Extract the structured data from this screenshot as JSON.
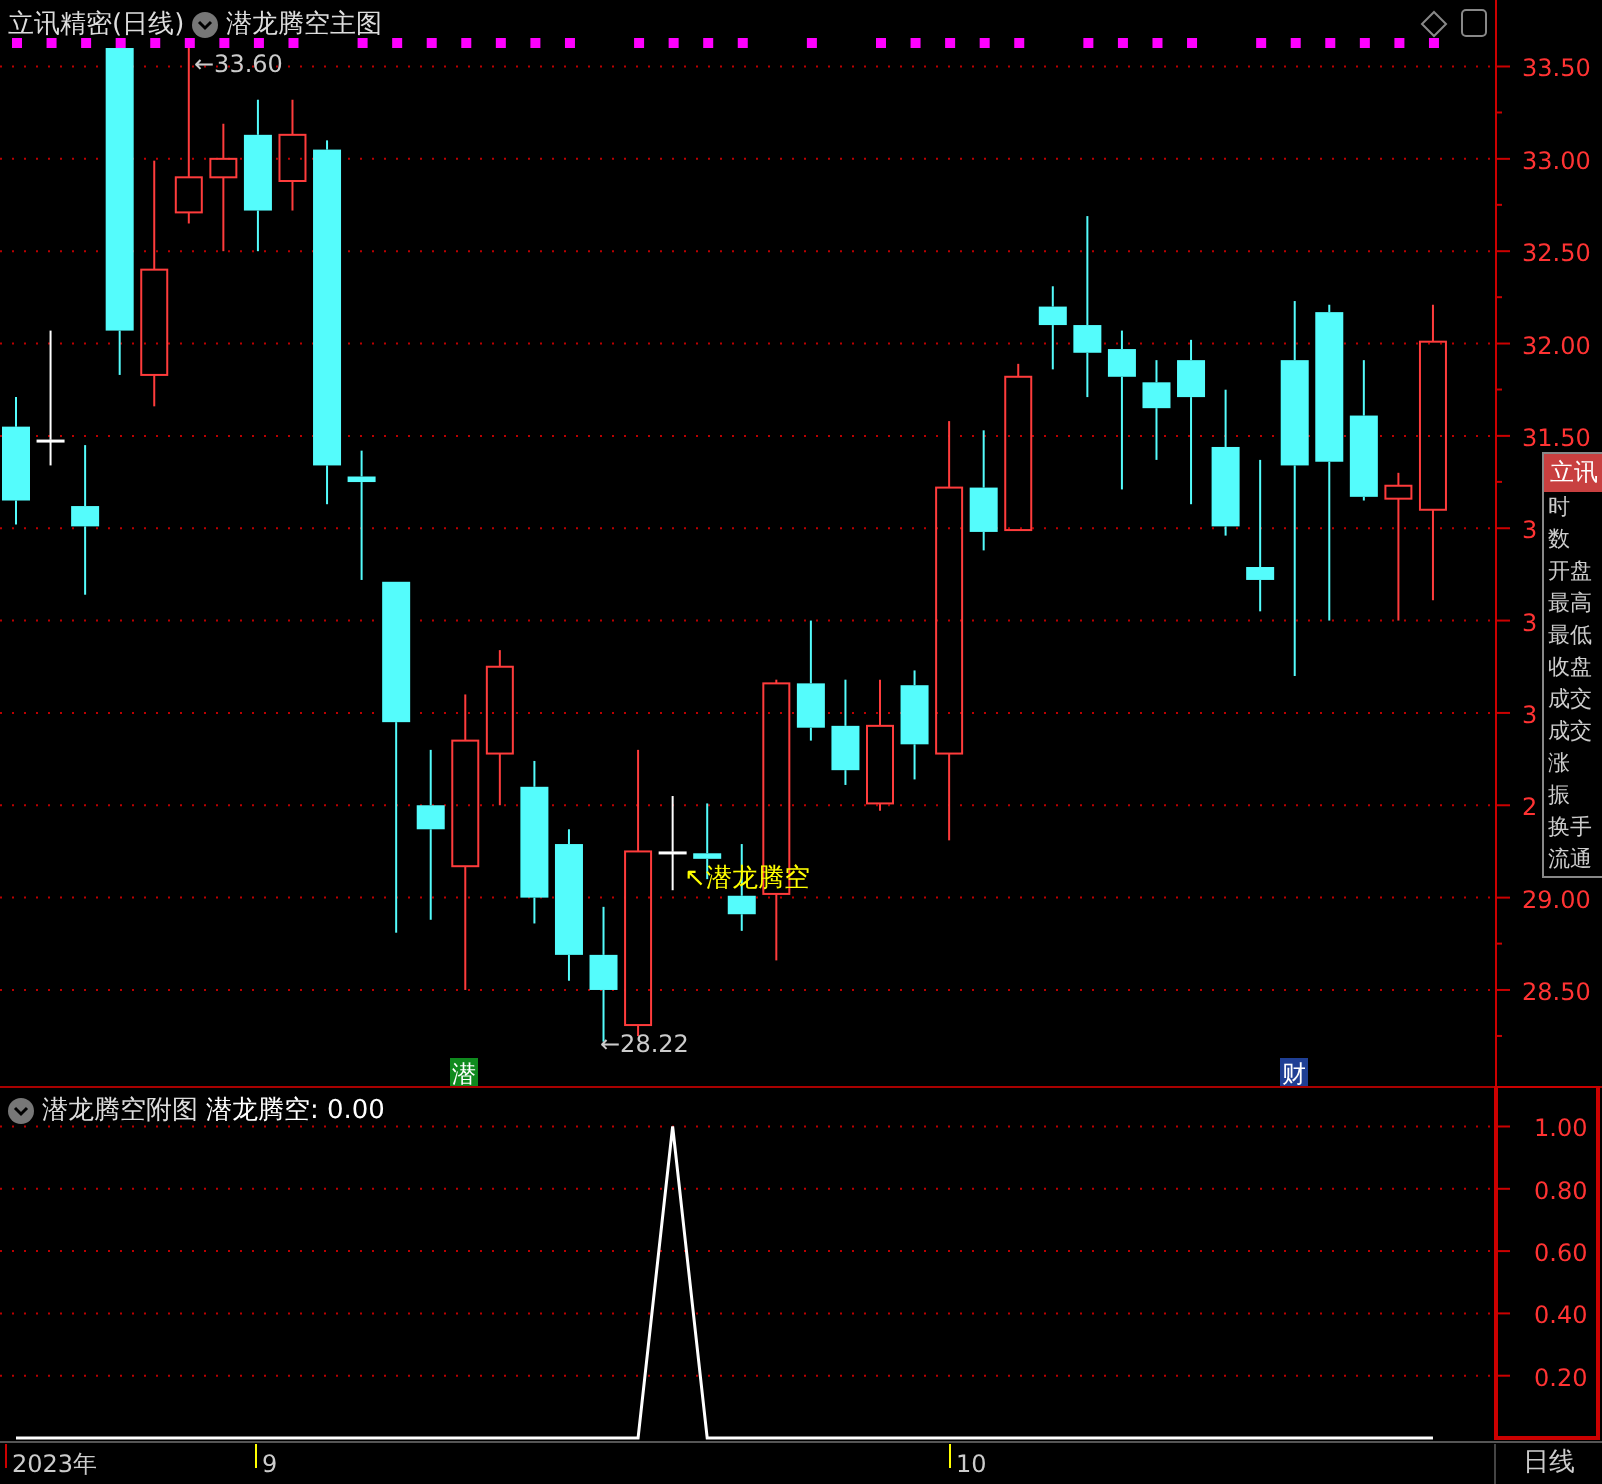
{
  "header": {
    "title": "立讯精密(日线)",
    "indicator": "潜龙腾空主图"
  },
  "main_chart": {
    "high_marker": "←33.60",
    "low_marker": "←28.22",
    "signal_label": "↖潜龙腾空",
    "covered_axis_labels": [
      "3",
      "3",
      "3",
      "2"
    ],
    "badges": [
      {
        "text": "潜",
        "color": "#0f8a1e"
      },
      {
        "text": "财",
        "color": "#1f3f94"
      }
    ],
    "chart_data": {
      "type": "candlestick",
      "grid": true,
      "ylim": [
        27.98,
        33.86
      ],
      "yticks": [
        {
          "value": 33.5,
          "label": "33.50"
        },
        {
          "value": 33,
          "label": "33.00"
        },
        {
          "value": 32.5,
          "label": "32.50"
        },
        {
          "value": 32,
          "label": "32.00"
        },
        {
          "value": 31.5,
          "label": "31.50"
        },
        {
          "value": 29,
          "label": "29.00"
        },
        {
          "value": 28.5,
          "label": "28.50"
        }
      ],
      "ohlc": [
        [
          31.55,
          31.71,
          31.02,
          31.15
        ],
        [
          31.48,
          32.07,
          31.34,
          31.48
        ],
        [
          31.12,
          31.45,
          30.64,
          31.01
        ],
        [
          33.6,
          33.6,
          31.83,
          32.07
        ],
        [
          31.83,
          32.99,
          31.66,
          32.4
        ],
        [
          32.71,
          33.6,
          32.65,
          32.9
        ],
        [
          32.9,
          33.19,
          32.5,
          33.0
        ],
        [
          33.13,
          33.32,
          32.5,
          32.72
        ],
        [
          32.88,
          33.32,
          32.72,
          33.13
        ],
        [
          33.05,
          33.1,
          31.13,
          31.34
        ],
        [
          31.28,
          31.42,
          30.72,
          31.25
        ],
        [
          30.71,
          30.71,
          28.81,
          29.95
        ],
        [
          29.5,
          29.8,
          28.88,
          29.37
        ],
        [
          29.17,
          30.1,
          28.5,
          29.85
        ],
        [
          29.78,
          30.34,
          29.5,
          30.25
        ],
        [
          29.6,
          29.74,
          28.86,
          29.0
        ],
        [
          29.29,
          29.37,
          28.55,
          28.69
        ],
        [
          28.69,
          28.95,
          28.22,
          28.5
        ],
        [
          28.31,
          29.8,
          28.25,
          29.25
        ],
        [
          29.25,
          29.55,
          29.04,
          29.25
        ],
        [
          29.24,
          29.51,
          29.1,
          29.21
        ],
        [
          29.01,
          29.29,
          28.82,
          28.91
        ],
        [
          29.02,
          30.18,
          28.66,
          30.16
        ],
        [
          30.16,
          30.5,
          29.85,
          29.92
        ],
        [
          29.93,
          30.18,
          29.61,
          29.69
        ],
        [
          29.51,
          30.18,
          29.47,
          29.93
        ],
        [
          30.15,
          30.23,
          29.64,
          29.83
        ],
        [
          29.78,
          31.58,
          29.31,
          31.22
        ],
        [
          31.22,
          31.53,
          30.88,
          30.98
        ],
        [
          30.99,
          31.89,
          30.99,
          31.82
        ],
        [
          32.2,
          32.31,
          31.86,
          32.1
        ],
        [
          32.1,
          32.69,
          31.71,
          31.95
        ],
        [
          31.97,
          32.07,
          31.21,
          31.82
        ],
        [
          31.79,
          31.91,
          31.37,
          31.65
        ],
        [
          31.91,
          32.02,
          31.13,
          31.71
        ],
        [
          31.44,
          31.75,
          30.96,
          31.01
        ],
        [
          30.79,
          31.37,
          30.55,
          30.72
        ],
        [
          31.91,
          32.23,
          30.2,
          31.34
        ],
        [
          32.17,
          32.21,
          30.5,
          31.36
        ],
        [
          31.61,
          31.91,
          31.15,
          31.17
        ],
        [
          31.16,
          31.3,
          30.5,
          31.23
        ],
        [
          31.1,
          32.21,
          30.61,
          32.01
        ]
      ]
    }
  },
  "tooltip": {
    "title": "立讯",
    "rows": [
      "时",
      "数",
      "开盘",
      "最高",
      "最低",
      "收盘",
      "成交",
      "成交",
      "涨",
      "振",
      "换手",
      "流通"
    ]
  },
  "sub_chart": {
    "title": "潜龙腾空附图",
    "reading": "潜龙腾空: 0.00",
    "chart_data": {
      "type": "line",
      "grid": true,
      "ylim": [
        0,
        1.13
      ],
      "yticks": [
        {
          "value": 1,
          "label": "1.00"
        },
        {
          "value": 0.8,
          "label": "0.80"
        },
        {
          "value": 0.6,
          "label": "0.60"
        },
        {
          "value": 0.4,
          "label": "0.40"
        },
        {
          "value": 0.2,
          "label": "0.20"
        }
      ],
      "values": [
        0,
        0,
        0,
        0,
        0,
        0,
        0,
        0,
        0,
        0,
        0,
        0,
        0,
        0,
        0,
        0,
        0,
        0,
        0,
        1,
        0,
        0,
        0,
        0,
        0,
        0,
        0,
        0,
        0,
        0,
        0,
        0,
        0,
        0,
        0,
        0,
        0,
        0,
        0,
        0,
        0,
        0
      ]
    }
  },
  "time_axis": [
    "2023年",
    "9",
    "10"
  ],
  "period": "日线"
}
